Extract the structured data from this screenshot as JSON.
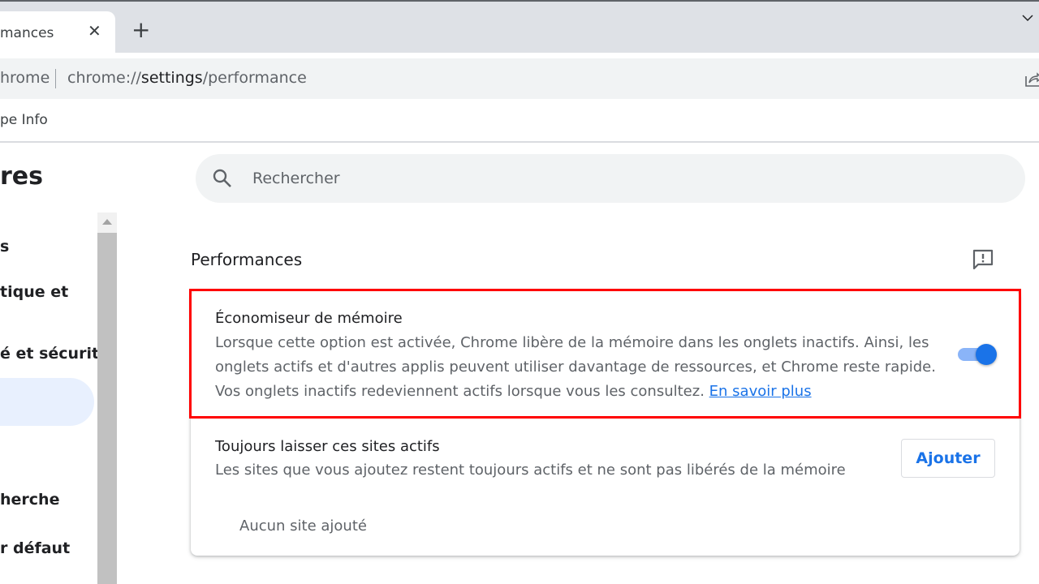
{
  "browser": {
    "tab": {
      "title": "mances",
      "close_glyph": "✕"
    },
    "new_tab_glyph": "+",
    "omnibox": {
      "site_label": "hrome",
      "url_prefix": "chrome://",
      "url_host": "settings",
      "url_path": "/performance"
    },
    "bookmarks": [
      {
        "label": "pe Info"
      }
    ]
  },
  "settings": {
    "page_title": "res",
    "nav": [
      {
        "label": "s"
      },
      {
        "label": "tique et"
      },
      {
        "label": "é et sécurité"
      },
      {
        "label": ""
      },
      {
        "label": "herche"
      },
      {
        "label": "r défaut"
      }
    ],
    "search": {
      "placeholder": "Rechercher"
    },
    "section_title": "Performances",
    "memory_saver": {
      "title": "Économiseur de mémoire",
      "description": "Lorsque cette option est activée, Chrome libère de la mémoire dans les onglets inactifs. Ainsi, les onglets actifs et d'autres applis peuvent utiliser davantage de ressources, et Chrome reste rapide. Vos onglets inactifs redeviennent actifs lorsque vous les consultez.",
      "link": "En savoir plus",
      "enabled": true
    },
    "always_active": {
      "title": "Toujours laisser ces sites actifs",
      "description": "Les sites que vous ajoutez restent toujours actifs et ne sont pas libérés de la mémoire",
      "add_button": "Ajouter",
      "empty": "Aucun site ajouté"
    }
  },
  "colors": {
    "accent": "#1a73e8",
    "highlight": "#ff0000",
    "toggle_track": "#8ab4f8"
  }
}
